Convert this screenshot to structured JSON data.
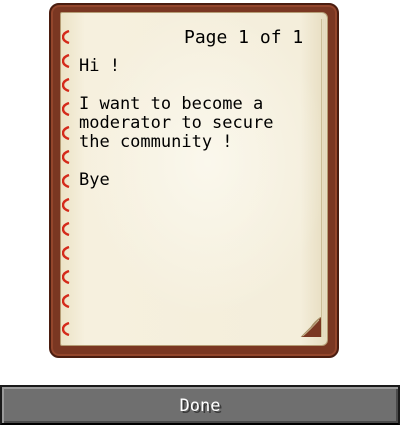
{
  "book": {
    "page_indicator": "Page 1 of 1",
    "lines": [
      "Hi !",
      "",
      "I want to become a",
      "moderator to secure",
      "the community !",
      "",
      "Bye"
    ]
  },
  "done_button": {
    "label": "Done"
  },
  "colors": {
    "cover": "#7a3722",
    "paper": "#f4eedc",
    "ring": "#d42a1a",
    "button": "#6f6f6f"
  },
  "icons": {
    "binding_ring": "binding-ring-icon",
    "page_curl": "page-curl-icon"
  }
}
